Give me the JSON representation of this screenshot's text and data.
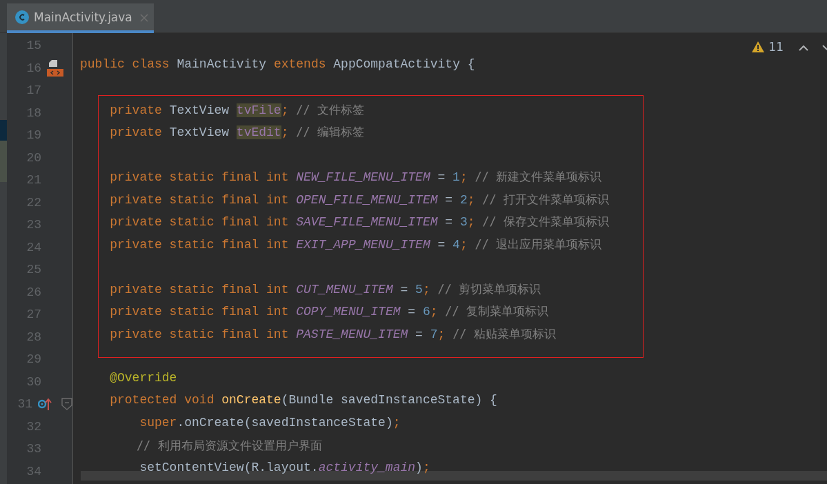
{
  "tabs": [
    {
      "label": "MainActivity.java",
      "selected": true
    }
  ],
  "inspections": {
    "count": "11"
  },
  "lines": [
    {
      "number": "15"
    },
    {
      "number": "16",
      "marker": {
        "kind": "class"
      },
      "tokens": [
        {
          "t": "public class ",
          "kind": "kw"
        },
        {
          "t": "MainActivity ",
          "kind": "text"
        },
        {
          "t": "extends ",
          "kind": "kw"
        },
        {
          "t": "AppCompatActivity {",
          "kind": "text"
        }
      ]
    },
    {
      "number": "17"
    },
    {
      "number": "18",
      "tokens": [
        {
          "t": "    private ",
          "kind": "kw"
        },
        {
          "t": "TextView ",
          "kind": "text"
        },
        {
          "t": "tvFile",
          "kind": "mark"
        },
        {
          "t": "; ",
          "kind": "kw"
        },
        {
          "t": "// 文件标签",
          "kind": "comment"
        }
      ]
    },
    {
      "number": "19",
      "tokens": [
        {
          "t": "    private ",
          "kind": "kw"
        },
        {
          "t": "TextView ",
          "kind": "text"
        },
        {
          "t": "tvEdit",
          "kind": "mark"
        },
        {
          "t": "; ",
          "kind": "kw"
        },
        {
          "t": "// 编辑标签",
          "kind": "comment"
        }
      ]
    },
    {
      "number": "20"
    },
    {
      "number": "21",
      "tokens": [
        {
          "t": "    private static final int ",
          "kind": "kw"
        },
        {
          "t": "NEW_FILE_MENU_ITEM",
          "kind": "field"
        },
        {
          "t": " = ",
          "kind": "text"
        },
        {
          "t": "1",
          "kind": "num"
        },
        {
          "t": "; ",
          "kind": "kw"
        },
        {
          "t": "// 新建文件菜单项标识",
          "kind": "comment"
        }
      ]
    },
    {
      "number": "22",
      "tokens": [
        {
          "t": "    private static final int ",
          "kind": "kw"
        },
        {
          "t": "OPEN_FILE_MENU_ITEM",
          "kind": "field"
        },
        {
          "t": " = ",
          "kind": "text"
        },
        {
          "t": "2",
          "kind": "num"
        },
        {
          "t": "; ",
          "kind": "kw"
        },
        {
          "t": "// 打开文件菜单项标识",
          "kind": "comment"
        }
      ]
    },
    {
      "number": "23",
      "tokens": [
        {
          "t": "    private static final int ",
          "kind": "kw"
        },
        {
          "t": "SAVE_FILE_MENU_ITEM",
          "kind": "field"
        },
        {
          "t": " = ",
          "kind": "text"
        },
        {
          "t": "3",
          "kind": "num"
        },
        {
          "t": "; ",
          "kind": "kw"
        },
        {
          "t": "// 保存文件菜单项标识",
          "kind": "comment"
        }
      ]
    },
    {
      "number": "24",
      "tokens": [
        {
          "t": "    private static final int ",
          "kind": "kw"
        },
        {
          "t": "EXIT_APP_MENU_ITEM",
          "kind": "field"
        },
        {
          "t": " = ",
          "kind": "text"
        },
        {
          "t": "4",
          "kind": "num"
        },
        {
          "t": "; ",
          "kind": "kw"
        },
        {
          "t": "// 退出应用菜单项标识",
          "kind": "comment"
        }
      ]
    },
    {
      "number": "25"
    },
    {
      "number": "26",
      "tokens": [
        {
          "t": "    private static final int ",
          "kind": "kw"
        },
        {
          "t": "CUT_MENU_ITEM",
          "kind": "field"
        },
        {
          "t": " = ",
          "kind": "text"
        },
        {
          "t": "5",
          "kind": "num"
        },
        {
          "t": "; ",
          "kind": "kw"
        },
        {
          "t": "// 剪切菜单项标识",
          "kind": "comment"
        }
      ]
    },
    {
      "number": "27",
      "tokens": [
        {
          "t": "    private static final int ",
          "kind": "kw"
        },
        {
          "t": "COPY_MENU_ITEM",
          "kind": "field"
        },
        {
          "t": " = ",
          "kind": "text"
        },
        {
          "t": "6",
          "kind": "num"
        },
        {
          "t": "; ",
          "kind": "kw"
        },
        {
          "t": "// 复制菜单项标识",
          "kind": "comment"
        }
      ]
    },
    {
      "number": "28",
      "tokens": [
        {
          "t": "    private static final int ",
          "kind": "kw"
        },
        {
          "t": "PASTE_MENU_ITEM",
          "kind": "field"
        },
        {
          "t": " = ",
          "kind": "text"
        },
        {
          "t": "7",
          "kind": "num"
        },
        {
          "t": "; ",
          "kind": "kw"
        },
        {
          "t": "// 粘贴菜单项标识",
          "kind": "comment"
        }
      ]
    },
    {
      "number": "29"
    },
    {
      "number": "30",
      "tokens": [
        {
          "t": "    @Override",
          "kind": "annotation"
        }
      ]
    },
    {
      "number": "31",
      "marker": {
        "kind": "override"
      },
      "tokens": [
        {
          "t": "    protected void ",
          "kind": "kw"
        },
        {
          "t": "onCreate",
          "kind": "method"
        },
        {
          "t": "(Bundle savedInstanceState) {",
          "kind": "text"
        }
      ]
    },
    {
      "number": "32",
      "tokens": [
        {
          "t": "        super",
          "kind": "kw"
        },
        {
          "t": ".onCreate(savedInstanceState)",
          "kind": "text"
        },
        {
          "t": ";",
          "kind": "kw"
        }
      ]
    },
    {
      "number": "33",
      "tokens": [
        {
          "t": "        // 利用布局资源文件设置用户界面",
          "kind": "comment"
        }
      ]
    },
    {
      "number": "34",
      "tokens": [
        {
          "t": "        setContentView(R.layout.",
          "kind": "text"
        },
        {
          "t": "activity_main",
          "kind": "field"
        },
        {
          "t": ")",
          "kind": "text"
        },
        {
          "t": ";",
          "kind": "kw"
        }
      ]
    }
  ]
}
